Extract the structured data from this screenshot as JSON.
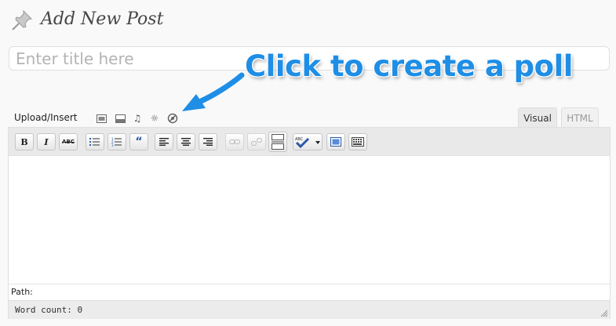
{
  "header": {
    "title": "Add New Post",
    "icon": "pushpin-icon"
  },
  "title_input": {
    "placeholder": "Enter title here",
    "value": ""
  },
  "annotation": {
    "text": "Click to create a poll",
    "color": "#1e8ee6"
  },
  "media_bar": {
    "label": "Upload/Insert",
    "icons": [
      "add-image-icon",
      "add-video-icon",
      "add-audio-icon",
      "add-media-icon",
      "create-poll-icon"
    ]
  },
  "tabs": [
    {
      "label": "Visual",
      "active": true
    },
    {
      "label": "HTML",
      "active": false
    }
  ],
  "toolbar": {
    "bold": "B",
    "italic": "I",
    "strikethrough": "ABC",
    "buttons": [
      "bold",
      "italic",
      "strikethrough",
      "unordered-list",
      "ordered-list",
      "blockquote",
      "align-left",
      "align-center",
      "align-right",
      "insert-link",
      "unlink",
      "insert-more",
      "spellcheck",
      "fullscreen",
      "kitchen-sink"
    ]
  },
  "editor": {
    "content": ""
  },
  "path": {
    "label": "Path:"
  },
  "status": {
    "word_count": "Word count: 0"
  }
}
